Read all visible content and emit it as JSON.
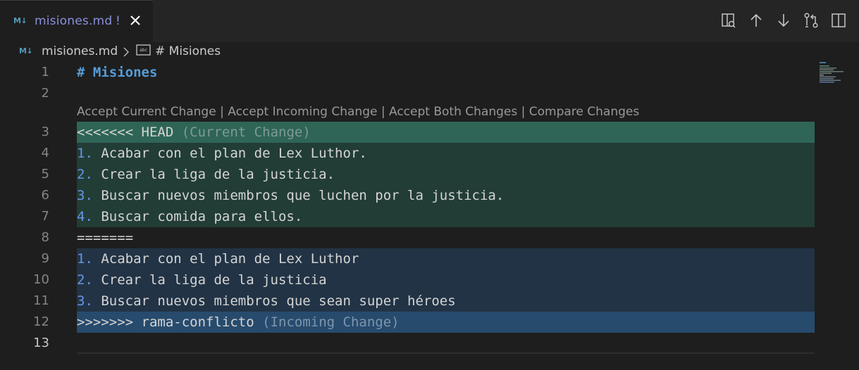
{
  "tab": {
    "badge": "M↓",
    "filename": "misiones.md",
    "dirty": "!"
  },
  "actions": [
    {
      "name": "open-preview-icon"
    },
    {
      "name": "previous-conflict-icon"
    },
    {
      "name": "next-conflict-icon"
    },
    {
      "name": "source-control-icon"
    },
    {
      "name": "split-editor-icon"
    }
  ],
  "breadcrumb": {
    "badge": "M↓",
    "file": "misiones.md",
    "heading": "# Misiones"
  },
  "codelens": {
    "accept_current": "Accept Current Change",
    "accept_incoming": "Accept Incoming Change",
    "accept_both": "Accept Both Changes",
    "compare": "Compare Changes",
    "separator": " | "
  },
  "lines": {
    "l1": {
      "n": "1",
      "heading": "# Misiones"
    },
    "l2": {
      "n": "2"
    },
    "l3": {
      "n": "3",
      "marker": "<<<<<<< HEAD",
      "label": "(Current Change)"
    },
    "l4": {
      "n": "4",
      "num": "1.",
      "text": " Acabar con el plan de Lex Luthor."
    },
    "l5": {
      "n": "5",
      "num": "2.",
      "text": " Crear la liga de la justicia."
    },
    "l6": {
      "n": "6",
      "num": "3.",
      "text": " Buscar nuevos miembros que luchen por la justicia."
    },
    "l7": {
      "n": "7",
      "num": "4.",
      "text": " Buscar comida para ellos."
    },
    "l8": {
      "n": "8",
      "text": "======="
    },
    "l9": {
      "n": "9",
      "num": "1.",
      "text": " Acabar con el plan de Lex Luthor"
    },
    "l10": {
      "n": "10",
      "num": "2.",
      "text": " Crear la liga de la justicia"
    },
    "l11": {
      "n": "11",
      "num": "3.",
      "text": " Buscar nuevos miembros que sean super héroes"
    },
    "l12": {
      "n": "12",
      "marker": ">>>>>>> rama-conflicto",
      "label": "(Incoming Change)"
    },
    "l13": {
      "n": "13"
    }
  },
  "colors": {
    "current_header": "#2e6556",
    "current_body": "#223d36",
    "incoming_body": "#223345",
    "incoming_header": "#274b6d",
    "accent": "#569cd6"
  }
}
